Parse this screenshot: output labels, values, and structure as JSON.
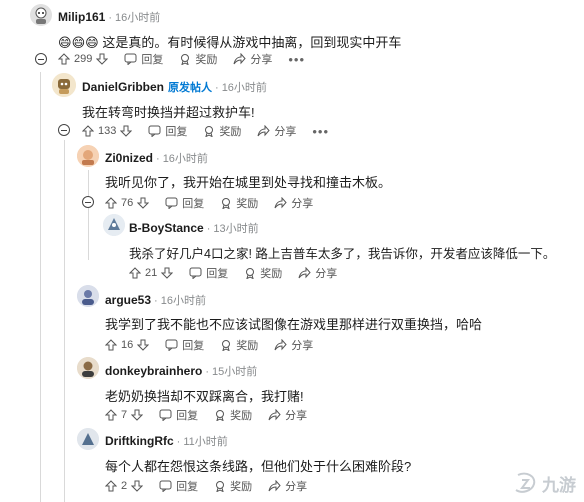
{
  "comments": [
    {
      "user": "Milip161",
      "time": "16小时前",
      "text": "这是真的。有时候得从游戏中抽离，回到现实中开车",
      "emojis": [
        "😄",
        "😄",
        "😄"
      ],
      "votes": "299",
      "reply": "回复",
      "award": "奖励",
      "share": "分享",
      "more": "•••"
    },
    {
      "user": "DanielGribben",
      "badge": "原发帖人",
      "time": "16小时前",
      "text": "我在转弯时换挡并超过救护车!",
      "votes": "133",
      "reply": "回复",
      "award": "奖励",
      "share": "分享",
      "more": "•••"
    },
    {
      "user": "Zi0nized",
      "time": "16小时前",
      "text": "我听见你了，我开始在城里到处寻找和撞击木板。",
      "votes": "76",
      "reply": "回复",
      "award": "奖励",
      "share": "分享"
    },
    {
      "user": "B-BoyStance",
      "time": "13小时前",
      "text": "我杀了好几户4口之家! 路上吉普车太多了，我告诉你，开发者应该降低一下。",
      "votes": "21",
      "reply": "回复",
      "award": "奖励",
      "share": "分享"
    },
    {
      "user": "argue53",
      "time": "16小时前",
      "text": "我学到了我不能也不应该试图像在游戏里那样进行双重换挡，哈哈",
      "votes": "16",
      "reply": "回复",
      "award": "奖励",
      "share": "分享"
    },
    {
      "user": "donkeybrainhero",
      "time": "15小时前",
      "text": "老奶奶换挡却不双踩离合，我打赌!",
      "votes": "7",
      "reply": "回复",
      "award": "奖励",
      "share": "分享"
    },
    {
      "user": "DriftkingRfc",
      "time": "11小时前",
      "text": "每个人都在怨恨这条线路，但他们处于什么困难阶段?",
      "votes": "2",
      "reply": "回复",
      "award": "奖励",
      "share": "分享"
    }
  ],
  "watermark": {
    "text": "九游"
  },
  "colors": {
    "accent": "#0079d3",
    "meta": "#878a8c",
    "thread": "#d9d9d9"
  }
}
